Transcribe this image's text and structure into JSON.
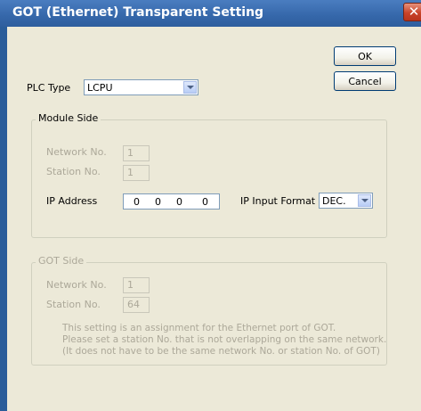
{
  "window": {
    "title": "GOT (Ethernet) Transparent Setting",
    "close_glyph": "✕"
  },
  "buttons": {
    "ok": "OK",
    "cancel": "Cancel"
  },
  "plc_type": {
    "label": "PLC Type",
    "value": "LCPU"
  },
  "module_side": {
    "title": "Module Side",
    "network_no_label": "Network No.",
    "network_no_value": "1",
    "station_no_label": "Station No.",
    "station_no_value": "1",
    "ip_address_label": "IP Address",
    "ip_octets": [
      "0",
      "0",
      "0",
      "0"
    ],
    "ip_format_label": "IP Input Format",
    "ip_format_value": "DEC."
  },
  "got_side": {
    "title": "GOT Side",
    "network_no_label": "Network No.",
    "network_no_value": "1",
    "station_no_label": "Station No.",
    "station_no_value": "64",
    "note_lines": [
      "This setting is an assignment for the Ethernet port of GOT.",
      "Please set a station No. that is not overlapping on the same network.",
      "(It does not have to be the same network No. or station No. of GOT)"
    ]
  }
}
